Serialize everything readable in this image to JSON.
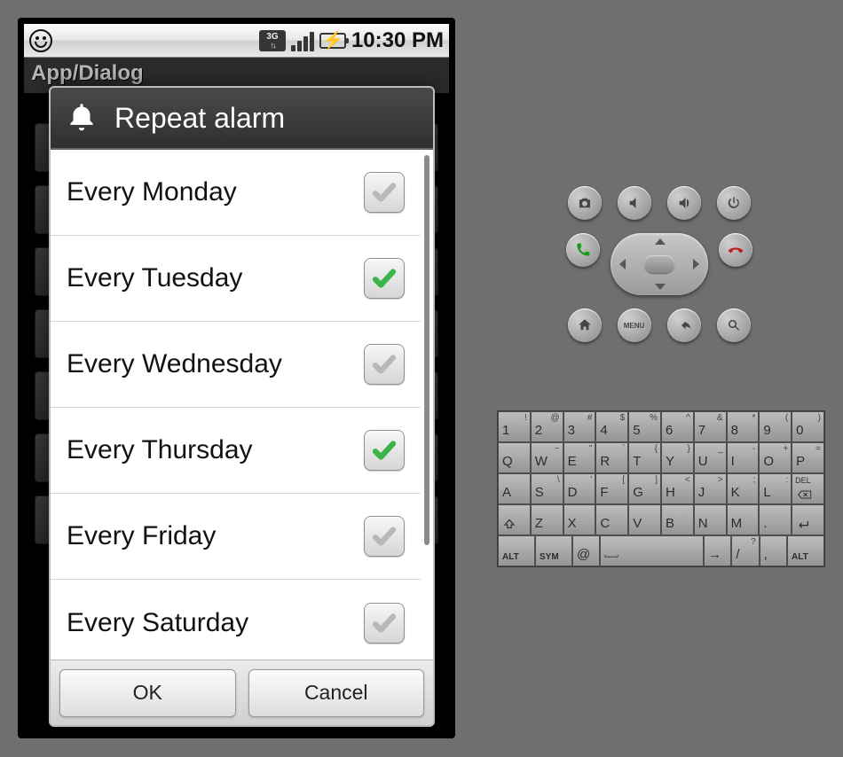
{
  "status": {
    "clock": "10:30 PM",
    "net_label": "3G"
  },
  "app": {
    "title": "App/Dialog",
    "bg_hint": "message"
  },
  "dialog": {
    "title": "Repeat alarm",
    "ok": "OK",
    "cancel": "Cancel",
    "items": [
      {
        "label": "Every Monday",
        "checked": false
      },
      {
        "label": "Every Tuesday",
        "checked": true
      },
      {
        "label": "Every Wednesday",
        "checked": false
      },
      {
        "label": "Every Thursday",
        "checked": true
      },
      {
        "label": "Every Friday",
        "checked": false
      },
      {
        "label": "Every Saturday",
        "checked": false
      }
    ]
  },
  "keyboard": {
    "rows": [
      [
        {
          "m": "1",
          "s": "!"
        },
        {
          "m": "2",
          "s": "@"
        },
        {
          "m": "3",
          "s": "#"
        },
        {
          "m": "4",
          "s": "$"
        },
        {
          "m": "5",
          "s": "%"
        },
        {
          "m": "6",
          "s": "^"
        },
        {
          "m": "7",
          "s": "&"
        },
        {
          "m": "8",
          "s": "*"
        },
        {
          "m": "9",
          "s": "("
        },
        {
          "m": "0",
          "s": ")"
        }
      ],
      [
        {
          "m": "Q",
          "s": ""
        },
        {
          "m": "W",
          "s": "~"
        },
        {
          "m": "E",
          "s": "\""
        },
        {
          "m": "R",
          "s": "`"
        },
        {
          "m": "T",
          "s": "{"
        },
        {
          "m": "Y",
          "s": "}"
        },
        {
          "m": "U",
          "s": "_"
        },
        {
          "m": "I",
          "s": "-"
        },
        {
          "m": "O",
          "s": "+"
        },
        {
          "m": "P",
          "s": "="
        }
      ],
      [
        {
          "m": "A",
          "s": ""
        },
        {
          "m": "S",
          "s": "\\"
        },
        {
          "m": "D",
          "s": "'"
        },
        {
          "m": "F",
          "s": "["
        },
        {
          "m": "G",
          "s": "]"
        },
        {
          "m": "H",
          "s": "<"
        },
        {
          "m": "J",
          "s": ">"
        },
        {
          "m": "K",
          "s": ";"
        },
        {
          "m": "L",
          "s": ":"
        },
        {
          "m": "DEL",
          "s": "",
          "del": true
        }
      ],
      [
        {
          "m": "⇧",
          "s": "",
          "shift": true
        },
        {
          "m": "Z",
          "s": ""
        },
        {
          "m": "X",
          "s": ""
        },
        {
          "m": "C",
          "s": ""
        },
        {
          "m": "V",
          "s": ""
        },
        {
          "m": "B",
          "s": ""
        },
        {
          "m": "N",
          "s": ""
        },
        {
          "m": "M",
          "s": ""
        },
        {
          "m": ".",
          "s": ""
        },
        {
          "m": "↵",
          "s": "",
          "enter": true
        }
      ],
      [
        {
          "m": "ALT",
          "s": "",
          "small": true,
          "w": 1.5
        },
        {
          "m": "SYM",
          "s": "",
          "small": true,
          "w": 1.5
        },
        {
          "m": "@",
          "s": "",
          "w": 1
        },
        {
          "m": "",
          "s": "",
          "space": true,
          "w": 5
        },
        {
          "m": "→",
          "s": "",
          "w": 1
        },
        {
          "m": "/",
          "s": "?",
          "w": 1
        },
        {
          "m": ",",
          "s": "",
          "w": 1
        },
        {
          "m": "ALT",
          "s": "",
          "small": true,
          "w": 1.5
        }
      ]
    ]
  }
}
